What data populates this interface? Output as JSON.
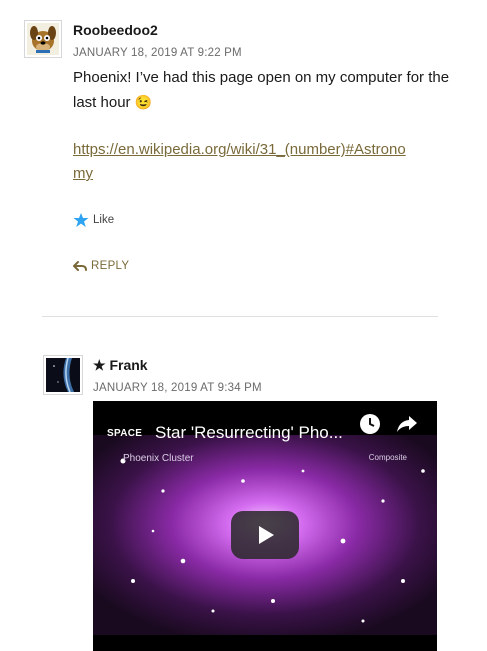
{
  "comments": [
    {
      "author": "Roobeedoo2",
      "date": "JANUARY 18, 2019 AT 9:22 PM",
      "text": "Phoenix! I’ve had this page open on my computer for the last hour",
      "emoji": "😉",
      "link_line1": "https://en.wikipedia.org/wiki/31_(number)#Astrono",
      "link_line2": "my",
      "like_label": "Like",
      "reply_label": "REPLY",
      "avatar": "scooby-doo-avatar"
    },
    {
      "author": "★ Frank",
      "date": "JANUARY 18, 2019 AT 9:34 PM",
      "avatar": "sky-photo-avatar",
      "video": {
        "channel_logo": "SPACE",
        "title": "Star 'Resurrecting' Pho...",
        "cluster_label": "Phoenix Cluster",
        "composite_label": "Composite",
        "icons": [
          "clock-icon",
          "share-icon",
          "play-icon"
        ]
      }
    }
  ],
  "colors": {
    "link": "#7a6a3a",
    "like_star": "#2ea3f2",
    "divider": "#e0e0e0"
  }
}
